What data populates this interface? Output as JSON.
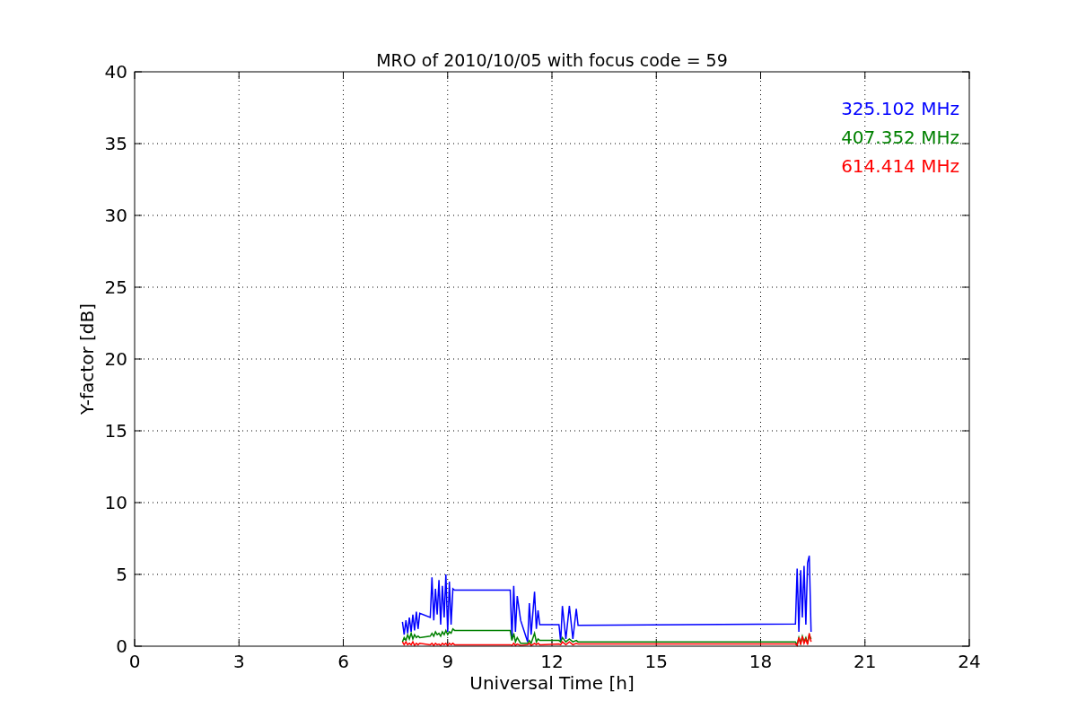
{
  "chart_data": {
    "type": "line",
    "grid": true,
    "title": "MRO of 2010/10/05 with focus code = 59",
    "xlabel": "Universal Time [h]",
    "ylabel": "Y-factor [dB]",
    "xlim": [
      0,
      24
    ],
    "ylim": [
      0,
      40
    ],
    "xticks": [
      0,
      3,
      6,
      9,
      12,
      15,
      18,
      21,
      24
    ],
    "yticks": [
      0,
      5,
      10,
      15,
      20,
      25,
      30,
      35,
      40
    ],
    "x": [
      7.7,
      7.75,
      7.8,
      7.85,
      7.9,
      7.95,
      8.0,
      8.05,
      8.1,
      8.15,
      8.2,
      8.5,
      8.55,
      8.6,
      8.65,
      8.7,
      8.75,
      8.8,
      8.85,
      8.9,
      8.95,
      9.0,
      9.05,
      9.1,
      9.15,
      9.2,
      10.8,
      10.85,
      10.9,
      10.95,
      11.0,
      11.1,
      11.3,
      11.35,
      11.4,
      11.5,
      11.55,
      11.6,
      11.65,
      12.2,
      12.25,
      12.3,
      12.4,
      12.5,
      12.6,
      12.7,
      12.75,
      19.0,
      19.05,
      19.1,
      19.15,
      19.2,
      19.25,
      19.3,
      19.35,
      19.4,
      19.45
    ],
    "series": [
      {
        "name": "325.102 MHz",
        "color": "#0000ff",
        "values": [
          1.7,
          0.8,
          1.8,
          0.9,
          2.0,
          1.0,
          2.2,
          1.1,
          2.4,
          1.2,
          2.3,
          2.0,
          4.8,
          1.8,
          4.0,
          2.2,
          4.6,
          1.5,
          4.2,
          2.0,
          5.0,
          1.0,
          4.5,
          1.5,
          4.0,
          3.9,
          3.9,
          0.5,
          4.2,
          1.0,
          3.5,
          1.8,
          0.3,
          3.0,
          0.8,
          3.8,
          1.2,
          2.5,
          1.5,
          1.5,
          0.3,
          2.8,
          0.5,
          2.8,
          0.5,
          2.6,
          1.45,
          1.55,
          5.4,
          1.0,
          5.3,
          2.0,
          5.6,
          1.5,
          5.8,
          6.3,
          1.0
        ]
      },
      {
        "name": "407.352 MHz",
        "color": "#008000",
        "values": [
          0.3,
          0.6,
          0.4,
          0.8,
          0.5,
          0.9,
          0.5,
          0.8,
          0.6,
          0.7,
          0.6,
          0.7,
          0.9,
          0.7,
          1.0,
          0.8,
          0.9,
          0.7,
          1.0,
          0.8,
          1.1,
          0.8,
          1.0,
          0.9,
          1.2,
          1.1,
          1.1,
          0.4,
          0.9,
          0.3,
          0.6,
          0.2,
          0.2,
          0.4,
          0.2,
          0.9,
          0.3,
          0.5,
          0.4,
          0.4,
          0.3,
          0.6,
          0.3,
          0.5,
          0.3,
          0.4,
          0.3,
          0.3,
          0.1,
          0.6,
          0.2,
          0.7,
          0.3,
          0.6,
          0.2,
          0.8,
          0.5
        ]
      },
      {
        "name": "614.414 MHz",
        "color": "#ff0000",
        "values": [
          0.3,
          0.1,
          0.3,
          0.1,
          0.2,
          0.1,
          0.3,
          0.05,
          0.2,
          0.1,
          0.2,
          0.1,
          0.2,
          0.05,
          0.2,
          0.1,
          0.15,
          0.05,
          0.2,
          0.1,
          0.2,
          0.05,
          0.2,
          0.1,
          0.2,
          0.1,
          0.1,
          0.05,
          0.2,
          0.05,
          0.15,
          0.05,
          0.1,
          0.2,
          0.05,
          0.2,
          0.1,
          0.2,
          0.1,
          0.15,
          0.1,
          0.3,
          0.1,
          0.3,
          0.1,
          0.2,
          0.15,
          0.15,
          0.05,
          0.6,
          0.1,
          0.7,
          0.2,
          0.5,
          0.1,
          0.9,
          0.3
        ]
      }
    ]
  }
}
